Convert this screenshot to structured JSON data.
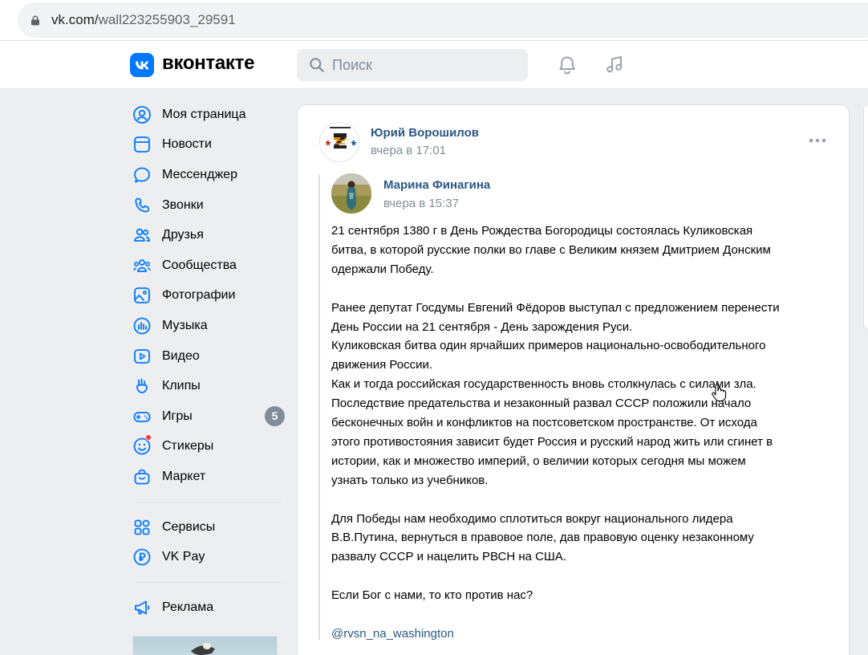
{
  "browser": {
    "url_host": "vk.com/",
    "url_path": "wall223255903_29591"
  },
  "header": {
    "logo_text": "вконтакте",
    "search_placeholder": "Поиск"
  },
  "sidebar": {
    "items": [
      {
        "label": "Моя страница",
        "icon": "user-circle-icon"
      },
      {
        "label": "Новости",
        "icon": "news-icon"
      },
      {
        "label": "Мессенджер",
        "icon": "message-icon"
      },
      {
        "label": "Звонки",
        "icon": "phone-icon"
      },
      {
        "label": "Друзья",
        "icon": "friends-icon"
      },
      {
        "label": "Сообщества",
        "icon": "communities-icon"
      },
      {
        "label": "Фотографии",
        "icon": "photos-icon"
      },
      {
        "label": "Музыка",
        "icon": "music-icon"
      },
      {
        "label": "Видео",
        "icon": "video-icon"
      },
      {
        "label": "Клипы",
        "icon": "clips-icon"
      },
      {
        "label": "Игры",
        "icon": "games-icon",
        "badge": "5"
      },
      {
        "label": "Стикеры",
        "icon": "stickers-icon"
      },
      {
        "label": "Маркет",
        "icon": "market-icon"
      }
    ],
    "secondary": [
      {
        "label": "Сервисы",
        "icon": "services-icon"
      },
      {
        "label": "VK Pay",
        "icon": "vkpay-icon"
      }
    ],
    "tertiary": [
      {
        "label": "Реклама",
        "icon": "megaphone-icon"
      }
    ]
  },
  "post": {
    "author": "Юрий Ворошилов",
    "time": "вчера в 17:01",
    "avatar_caption": "1945 - 2022",
    "repost": {
      "author": "Марина Финагина",
      "time": "вчера в 15:37"
    },
    "lines": [
      "21 сентября 1380 г в День Рождества Богородицы состоялась Куликовская",
      "битва, в которой русские полки во главе с Великим князем Дмитрием Донским",
      "одержали Победу.",
      "",
      "Ранее депутат Госдумы Евгений Фёдоров выступал с предложением перенести",
      "День России на 21 сентября - День зарождения Руси.",
      "Куликовская битва один ярчайших примеров национально-освободительного",
      "движения России.",
      "Как и тогда российская государственность вновь столкнулась с силами зла.",
      "Последствие предательства и незаконный развал СССР положили начало",
      "бесконечных войн и конфликтов на постсоветском пространстве. От исхода",
      "этого противостояния зависит будет Россия и русский народ жить или сгинет в",
      "истории, как и множество империй, о величии которых сегодня мы можем",
      "узнать только из учебников.",
      "",
      "Для Победы нам необходимо сплотиться вокруг национального лидера",
      "В.В.Путина, вернуться в правовое поле, дав правовую оценку незаконному",
      "развалу СССР и нацелить РВСН на США.",
      "",
      "Если Бог с нами, то кто против нас?",
      ""
    ],
    "mention": "@rvsn_na_washington"
  },
  "colors": {
    "vk_blue": "#0077ff",
    "link": "#2a5885",
    "secondary_text": "#818c99",
    "badge": "#818c99",
    "background": "#edeef0"
  }
}
